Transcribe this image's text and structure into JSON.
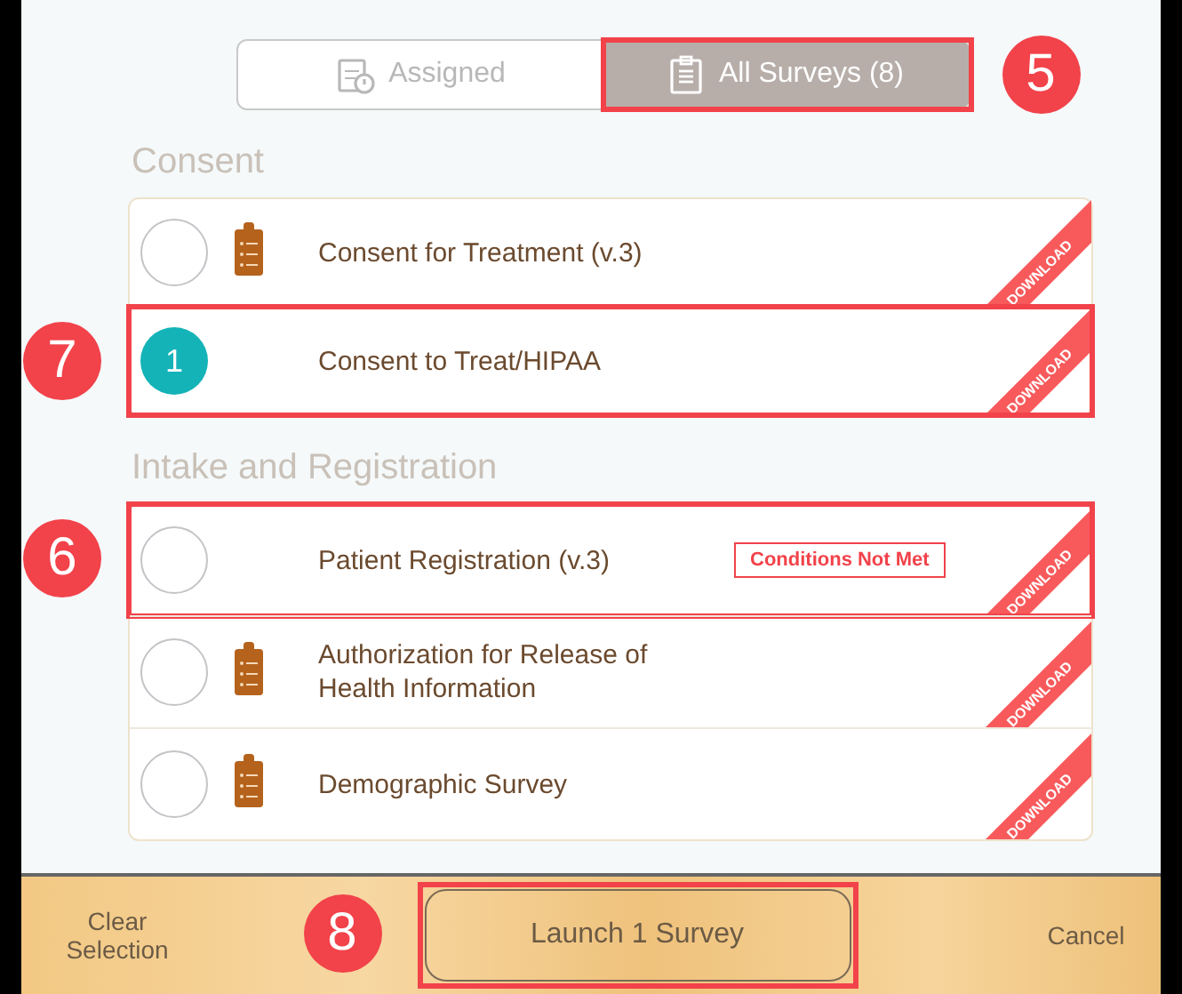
{
  "tabs": [
    {
      "label": "Assigned",
      "selected": false,
      "kind": "alert"
    },
    {
      "label": "All Surveys (8)",
      "selected": true,
      "kind": "list"
    }
  ],
  "tabs_callout": "5",
  "sections": [
    {
      "title": "Consent",
      "surveys": [
        {
          "title": "Consent for Treatment (v.3)",
          "selected": false,
          "clipboard": true,
          "ribbon": "DOWNLOAD"
        },
        {
          "title": "Consent to Treat/HIPAA",
          "selected": true,
          "order": "1",
          "clipboard": false,
          "ribbon": "DOWNLOAD",
          "callout": "7"
        }
      ]
    },
    {
      "title": "Intake and Registration",
      "surveys": [
        {
          "title": "Patient Registration (v.3)",
          "selected": false,
          "clipboard": false,
          "ribbon": "DOWNLOAD",
          "badge": "Conditions Not Met",
          "callout": "6"
        },
        {
          "title": "Authorization for Release of Health Information",
          "selected": false,
          "clipboard": true,
          "ribbon": "DOWNLOAD"
        },
        {
          "title": "Demographic Survey",
          "selected": false,
          "clipboard": true,
          "ribbon": "DOWNLOAD"
        }
      ]
    }
  ],
  "footer": {
    "clear": "Clear Selection",
    "launch": "Launch 1 Survey",
    "launch_callout": "8",
    "cancel": "Cancel"
  }
}
